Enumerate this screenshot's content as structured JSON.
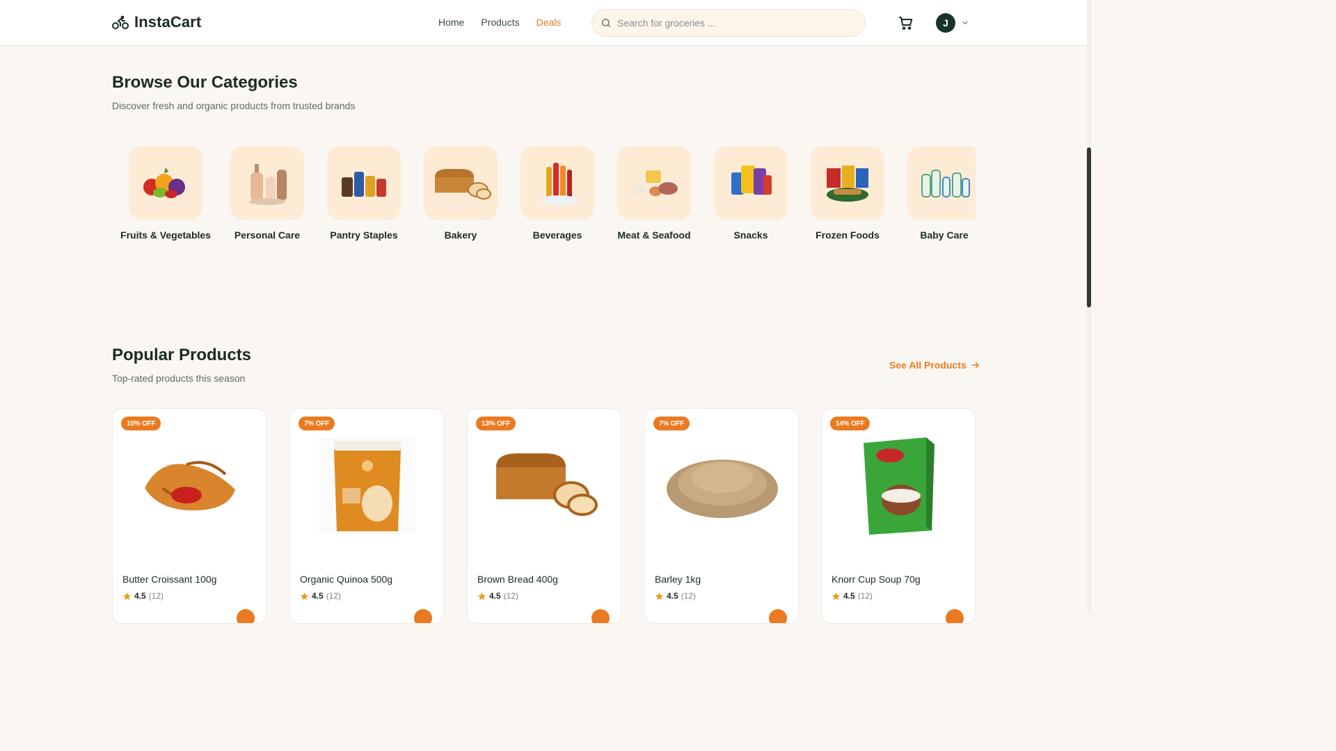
{
  "header": {
    "brand": "InstaCart",
    "nav": [
      {
        "label": "Home"
      },
      {
        "label": "Products"
      },
      {
        "label": "Deals"
      }
    ],
    "search_placeholder": "Search for groceries ...",
    "avatar_initial": "J"
  },
  "categories": {
    "title": "Browse Our Categories",
    "subtitle": "Discover fresh and organic products from trusted brands",
    "items": [
      {
        "label": "Fruits & Vegetables"
      },
      {
        "label": "Personal Care"
      },
      {
        "label": "Pantry Staples"
      },
      {
        "label": "Bakery"
      },
      {
        "label": "Beverages"
      },
      {
        "label": "Meat & Seafood"
      },
      {
        "label": "Snacks"
      },
      {
        "label": "Frozen Foods"
      },
      {
        "label": "Baby Care"
      }
    ]
  },
  "popular": {
    "title": "Popular Products",
    "subtitle": "Top-rated products this season",
    "see_all": "See All Products",
    "products": [
      {
        "badge": "10% OFF",
        "name": "Butter Croissant 100g",
        "rating": "4.5",
        "count": "(12)"
      },
      {
        "badge": "7% OFF",
        "name": "Organic Quinoa 500g",
        "rating": "4.5",
        "count": "(12)"
      },
      {
        "badge": "13% OFF",
        "name": "Brown Bread 400g",
        "rating": "4.5",
        "count": "(12)"
      },
      {
        "badge": "7% OFF",
        "name": "Barley 1kg",
        "rating": "4.5",
        "count": "(12)"
      },
      {
        "badge": "14% OFF",
        "name": "Knorr Cup Soup 70g",
        "rating": "4.5",
        "count": "(12)"
      }
    ]
  },
  "colors": {
    "accent": "#ea7a20",
    "brand_dark": "#17332a",
    "page_bg": "#faf7f2",
    "tile_bg": "#fdebd6"
  },
  "icons": [
    "bicycle-logo-icon",
    "search-icon",
    "cart-icon",
    "chevron-down-icon",
    "arrow-right-icon",
    "star-icon"
  ]
}
